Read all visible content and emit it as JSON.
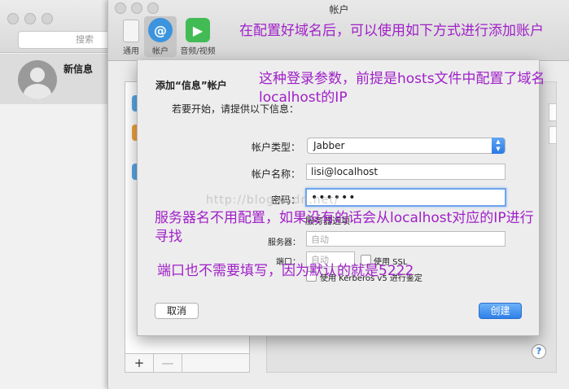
{
  "messages_window": {
    "search_placeholder": "搜索",
    "conversation": {
      "name": "新信息"
    }
  },
  "preferences": {
    "title": "帐户",
    "toolbar": [
      {
        "label": "通用",
        "icon": "phone-icon"
      },
      {
        "label": "帐户",
        "icon": "at-icon",
        "selected": true
      },
      {
        "label": "音频/视频",
        "icon": "video-camera-icon"
      }
    ],
    "account_list_footer": {
      "add": "+",
      "remove": "—"
    },
    "help": "?"
  },
  "sheet": {
    "title": "添加“信息”帐户",
    "subtitle": "若要开始，请提供以下信息：",
    "account_type_label": "帐户类型：",
    "account_type_value": "Jabber",
    "account_name_label": "帐户名称：",
    "account_name_value": "lisi@localhost",
    "password_label": "密码：",
    "password_value": "••••••",
    "server_options_label": "服务器选项",
    "server_label": "服务器：",
    "server_placeholder": "自动",
    "port_label": "端口：",
    "port_placeholder": "自动",
    "ssl_label": "使用 SSL",
    "kerberos_label": "使用 Kerberos v5 进行鉴定",
    "cancel_label": "取消",
    "create_label": "创建"
  },
  "annotations": {
    "note1": "在配置好域名后，可以使用如下方式进行添加账户",
    "note2": "这种登录参数，前提是hosts文件中配置了域名localhost的IP",
    "note3": "服务器名不用配置，如果没有的话会从localhost对应的IP进行寻找",
    "note4": "端口也不需要填写，因为默认的就是5222",
    "watermark": "http://blog.csdn.net/"
  },
  "colors": {
    "accent": "#2f7fe8",
    "annotation": "#a020c8",
    "desktop": "#0b7a2c"
  }
}
